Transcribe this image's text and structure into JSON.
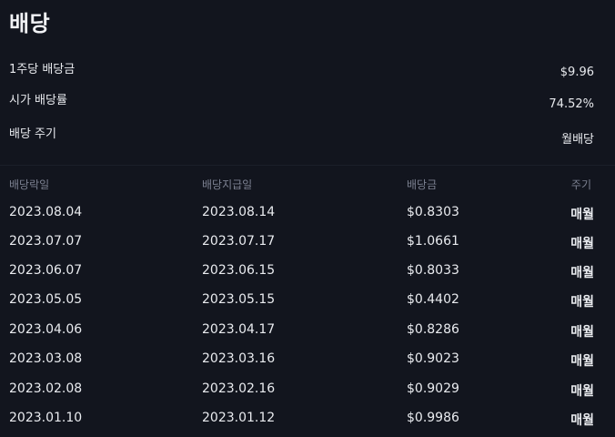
{
  "title": "배당",
  "summary": [
    {
      "label": "1주당 배당금",
      "value": "$9.96"
    },
    {
      "label": "시가 배당률",
      "value": "74.52%"
    },
    {
      "label": "배당 주기",
      "value": "월배당"
    }
  ],
  "table": {
    "headers": [
      "배당락일",
      "배당지급일",
      "배당금",
      "주기"
    ],
    "rows": [
      {
        "ex_date": "2023.08.04",
        "pay_date": "2023.08.14",
        "amount": "$0.8303",
        "cycle": "매월"
      },
      {
        "ex_date": "2023.07.07",
        "pay_date": "2023.07.17",
        "amount": "$1.0661",
        "cycle": "매월"
      },
      {
        "ex_date": "2023.06.07",
        "pay_date": "2023.06.15",
        "amount": "$0.8033",
        "cycle": "매월"
      },
      {
        "ex_date": "2023.05.05",
        "pay_date": "2023.05.15",
        "amount": "$0.4402",
        "cycle": "매월"
      },
      {
        "ex_date": "2023.04.06",
        "pay_date": "2023.04.17",
        "amount": "$0.8286",
        "cycle": "매월"
      },
      {
        "ex_date": "2023.03.08",
        "pay_date": "2023.03.16",
        "amount": "$0.9023",
        "cycle": "매월"
      },
      {
        "ex_date": "2023.02.08",
        "pay_date": "2023.02.16",
        "amount": "$0.9029",
        "cycle": "매월"
      },
      {
        "ex_date": "2023.01.10",
        "pay_date": "2023.01.12",
        "amount": "$0.9986",
        "cycle": "매월"
      }
    ]
  }
}
